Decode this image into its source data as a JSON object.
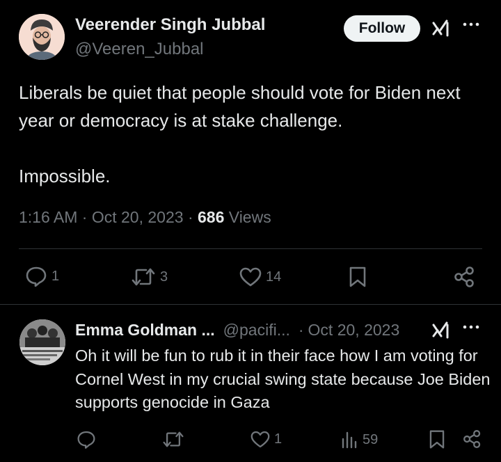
{
  "tweet": {
    "author_name": "Veerender Singh Jubbal",
    "author_handle": "@Veeren_Jubbal",
    "follow_label": "Follow",
    "text_line1": "Liberals be quiet that people should vote for Biden next year or democracy is at stake challenge.",
    "text_line2": "Impossible.",
    "time": "1:16 AM",
    "sep1": "·",
    "date": "Oct 20, 2023",
    "sep2": "·",
    "views_count": "686",
    "views_label": "Views",
    "replies": "1",
    "reposts": "3",
    "likes": "14"
  },
  "reply": {
    "author_name": "Emma Goldman ...",
    "author_handle": "@pacifi...",
    "sep": "·",
    "date": "Oct 20, 2023",
    "text": "Oh it will be fun to rub it in their face how I am voting for Cornel West in my crucial swing state because Joe Biden supports genocide in Gaza",
    "likes": "1",
    "views": "59"
  },
  "icons": {
    "more": "more-icon",
    "grok": "grok-icon",
    "reply": "reply-icon",
    "repost": "repost-icon",
    "like": "heart-icon",
    "bookmark": "bookmark-icon",
    "share": "share-icon",
    "views": "views-icon"
  },
  "colors": {
    "background": "#000000",
    "text": "#e7e9ea",
    "secondary": "#71767b",
    "divider": "#2f3336",
    "follow_bg": "#eff3f4"
  }
}
